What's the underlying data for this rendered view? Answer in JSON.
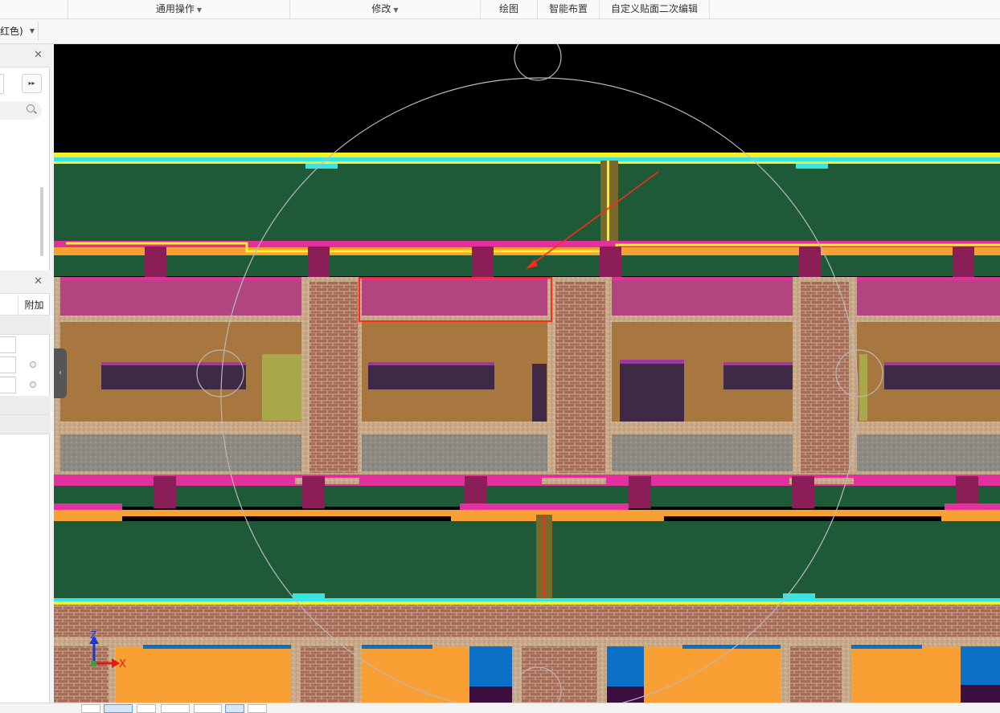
{
  "ribbon": {
    "groups": [
      {
        "label": "通用操作",
        "has_menu": true
      },
      {
        "label": "修改",
        "has_menu": true
      },
      {
        "label": "绘图",
        "has_menu": false
      },
      {
        "label": "智能布置",
        "has_menu": false
      },
      {
        "label": "自定义贴面二次编辑",
        "has_menu": false
      }
    ]
  },
  "toolbar": {
    "color_combo_value": "红色)"
  },
  "left_panel": {
    "column_header": "附加"
  },
  "viewport": {
    "colors": {
      "background": "#000000",
      "slab_green": "#1f5a38",
      "beam_magenta": "#e2319c",
      "beam_pink": "#b0457f",
      "wall_orange": "#a8773f",
      "window_purple": "#3f2a45",
      "brick": "#a86a55",
      "mortar_sand": "#c9ab8a",
      "concrete_gray": "#8e8b85",
      "cyan": "#36e6e6",
      "yellow": "#f5ef2a",
      "bright_orange": "#f8a033",
      "blue": "#0c6fc8",
      "red_annotation": "#ff2a1a"
    },
    "axis": {
      "z_label": "Z",
      "x_label": "X"
    }
  }
}
